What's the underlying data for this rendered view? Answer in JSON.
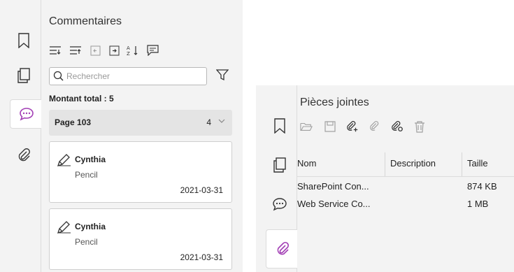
{
  "comments_panel": {
    "title": "Commentaires",
    "search_placeholder": "Rechercher",
    "total_label": "Montant total : 5",
    "page_group": {
      "label": "Page 103",
      "count": "4"
    },
    "comments": [
      {
        "author": "Cynthia",
        "type": "Pencil",
        "date": "2021-03-31"
      },
      {
        "author": "Cynthia",
        "type": "Pencil",
        "date": "2021-03-31"
      }
    ]
  },
  "attachments_panel": {
    "title": "Pièces jointes",
    "columns": [
      "Nom",
      "Description",
      "Taille"
    ],
    "rows": [
      {
        "name": "SharePoint Con...",
        "description": "",
        "size": "874 KB"
      },
      {
        "name": "Web Service Co...",
        "description": "",
        "size": "1 MB"
      }
    ]
  },
  "colors": {
    "accent": "#a23fb5",
    "border": "#dcdcdc",
    "panel": "#f3f3f3"
  }
}
